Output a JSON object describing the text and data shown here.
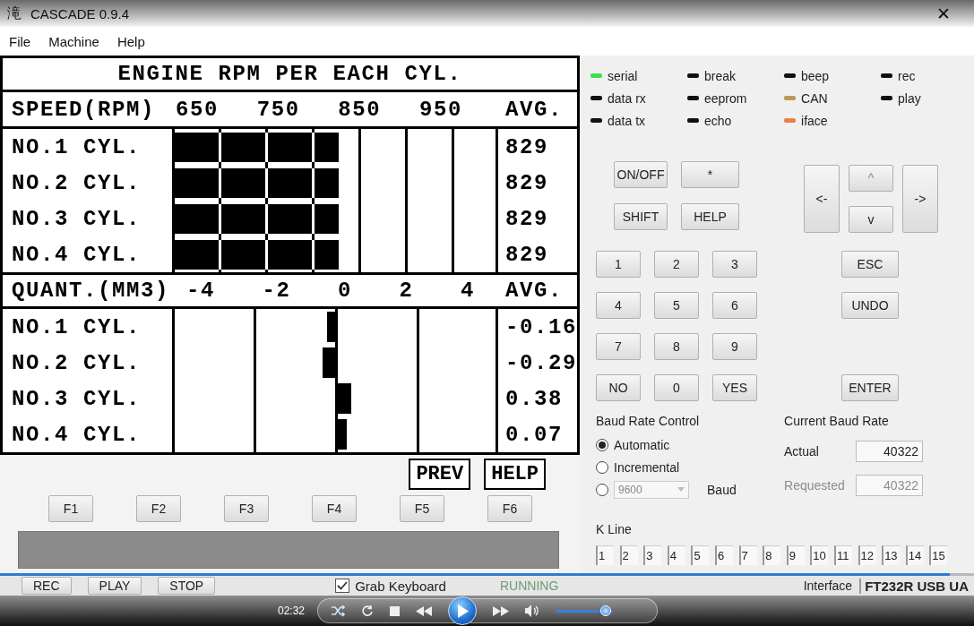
{
  "window": {
    "icon_glyph": "滝",
    "title": "CASCADE 0.9.4",
    "close": "✕"
  },
  "menu": [
    "File",
    "Machine",
    "Help"
  ],
  "display": {
    "title": "ENGINE RPM PER EACH CYL.",
    "sections": [
      {
        "kind": "bar",
        "heading": "SPEED(RPM)",
        "ticks": [
          "650",
          "750",
          "850",
          "950"
        ],
        "avg_label": "AVG.",
        "rows": [
          {
            "label": "NO.1 CYL.",
            "level": 0.51,
            "value": "829"
          },
          {
            "label": "NO.2 CYL.",
            "level": 0.51,
            "value": "829"
          },
          {
            "label": "NO.3 CYL.",
            "level": 0.51,
            "value": "829"
          },
          {
            "label": "NO.4 CYL.",
            "level": 0.51,
            "value": "829"
          }
        ]
      },
      {
        "kind": "diverging",
        "heading": "QUANT.(MM3)",
        "ticks": [
          "-4",
          "-2",
          "0",
          "2",
          "4"
        ],
        "avg_label": "AVG.",
        "rows": [
          {
            "label": "NO.1 CYL.",
            "level": 0.475,
            "value": "-0.16"
          },
          {
            "label": "NO.2 CYL.",
            "level": 0.46,
            "value": "-0.29"
          },
          {
            "label": "NO.3 CYL.",
            "level": 0.55,
            "value": "0.38"
          },
          {
            "label": "NO.4 CYL.",
            "level": 0.535,
            "value": "0.07"
          }
        ]
      }
    ]
  },
  "display_buttons": [
    "PREV",
    "HELP"
  ],
  "function_keys": [
    "F1",
    "F2",
    "F3",
    "F4",
    "F5",
    "F6"
  ],
  "indicators": [
    {
      "label": "serial",
      "color": "#3ee04a"
    },
    {
      "label": "break",
      "color": "#111111"
    },
    {
      "label": "beep",
      "color": "#111111"
    },
    {
      "label": "rec",
      "color": "#111111"
    },
    {
      "label": "data rx",
      "color": "#111111"
    },
    {
      "label": "eeprom",
      "color": "#111111"
    },
    {
      "label": "CAN",
      "color": "#b89a5a"
    },
    {
      "label": "play",
      "color": "#111111"
    },
    {
      "label": "data tx",
      "color": "#111111"
    },
    {
      "label": "echo",
      "color": "#111111"
    },
    {
      "label": "iface",
      "color": "#e8804a"
    }
  ],
  "keypad": {
    "top": [
      "ON/OFF",
      "*",
      "SHIFT",
      "HELP"
    ],
    "arrows": [
      {
        "label": "<-",
        "disabled": false
      },
      {
        "label": "^",
        "disabled": true
      },
      {
        "label": "v",
        "disabled": false
      },
      {
        "label": "->",
        "disabled": false
      }
    ],
    "numbers": [
      "1",
      "2",
      "3",
      "4",
      "5",
      "6",
      "7",
      "8",
      "9",
      "NO",
      "0",
      "YES"
    ],
    "side": [
      "ESC",
      "UNDO",
      "ENTER"
    ]
  },
  "baud_control": {
    "title": "Baud Rate Control",
    "options": [
      {
        "kind": "plain",
        "label": "Automatic",
        "selected": true
      },
      {
        "kind": "plain",
        "label": "Incremental",
        "selected": false
      },
      {
        "kind": "custom",
        "value": "9600",
        "unit": "Baud",
        "selected": false
      }
    ]
  },
  "current_baud": {
    "title": "Current Baud Rate",
    "fields": [
      {
        "label": "Actual",
        "value": "40322",
        "disabled": false
      },
      {
        "label": "Requested",
        "value": "40322",
        "disabled": true
      }
    ]
  },
  "k_line": {
    "title": "K Line",
    "pins": [
      "1",
      "2",
      "3",
      "4",
      "5",
      "6",
      "7",
      "8",
      "9",
      "10",
      "11",
      "12",
      "13",
      "14",
      "15"
    ]
  },
  "status": {
    "buttons": [
      "REC",
      "PLAY",
      "STOP"
    ],
    "grab_keyboard": {
      "label": "Grab Keyboard",
      "checked": true
    },
    "state": "RUNNING",
    "interface": {
      "label": "Interface",
      "value": "FT232R USB UA"
    }
  },
  "player": {
    "time": "02:32",
    "seek": {
      "level": 0.975
    },
    "volume": {
      "level": 0.88
    }
  }
}
